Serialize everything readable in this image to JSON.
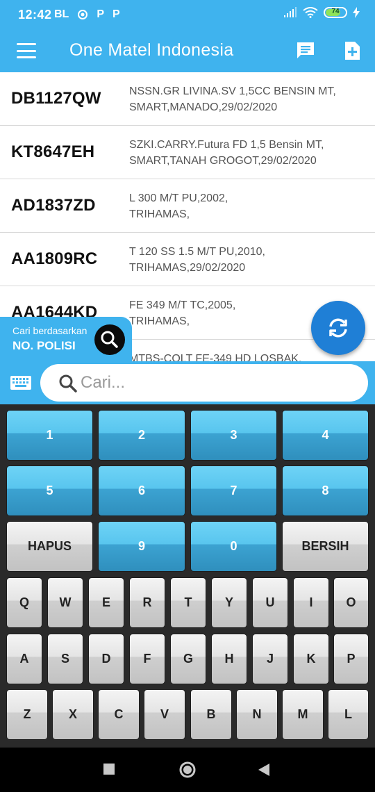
{
  "status_bar": {
    "time": "12:42",
    "left_icons": [
      "BL",
      "P",
      "P"
    ],
    "battery": "74",
    "battery_level": 0.74
  },
  "app_bar": {
    "title": "One Matel Indonesia",
    "menu_icon": "hamburger-menu-icon",
    "message_icon": "message-icon",
    "add_file_icon": "add-file-icon"
  },
  "list": [
    {
      "plate": "DB1127QW",
      "line1": "NSSN.GR LIVINA.SV 1,5CC BENSIN MT,",
      "line2": "SMART,MANADO,29/02/2020"
    },
    {
      "plate": "KT8647EH",
      "line1": "SZKI.CARRY.Futura FD 1,5 Bensin MT,",
      "line2": "SMART,TANAH GROGOT,29/02/2020"
    },
    {
      "plate": "AD1837ZD",
      "line1": "L 300 M/T PU,2002,",
      "line2": "TRIHAMAS,"
    },
    {
      "plate": "AA1809RC",
      "line1": "T 120 SS 1.5 M/T PU,2010,",
      "line2": "TRIHAMAS,29/02/2020"
    },
    {
      "plate": "AA1644KD",
      "line1": "FE 349 M/T TC,2005,",
      "line2": "TRIHAMAS,"
    },
    {
      "plate": "",
      "line1": "MTBS-COLT FE-349 HD LOSBAK,",
      "line2": ""
    }
  ],
  "search_by": {
    "label": "Cari berdasarkan",
    "value": "NO. POLISI"
  },
  "search": {
    "placeholder": "Cari..."
  },
  "keypad": {
    "num_rows": [
      [
        "1",
        "2",
        "3",
        "4"
      ],
      [
        "5",
        "6",
        "7",
        "8"
      ]
    ],
    "third_row": [
      "HAPUS",
      "9",
      "0",
      "BERSIH"
    ],
    "letter_rows": [
      [
        "Q",
        "W",
        "E",
        "R",
        "T",
        "Y",
        "U",
        "I",
        "O"
      ],
      [
        "A",
        "S",
        "D",
        "F",
        "G",
        "H",
        "J",
        "K",
        "P"
      ],
      [
        "Z",
        "X",
        "C",
        "V",
        "B",
        "N",
        "M",
        "L"
      ]
    ]
  },
  "colors": {
    "primary": "#3fb3ee",
    "fab": "#1f7fd6",
    "keypad_bg": "#2a2a2a"
  }
}
